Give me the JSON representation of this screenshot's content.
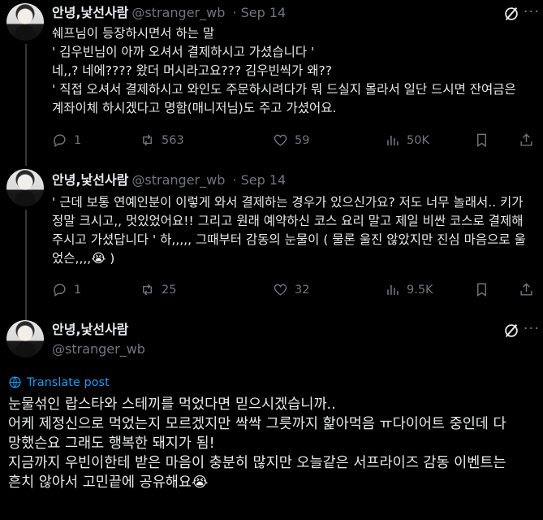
{
  "tweets": [
    {
      "author": "안녕,낯선사람",
      "handle": "@stranger_wb",
      "date": "Sep 14",
      "text": "쉐프님이 등장하시면서 하는 말\n' 김우빈님이 아까 오셔서 결제하시고 가셨습니다 '\n네,,? 네에???? 왔더 머시라고요??? 김우빈씩가 왜??\n' 직접 오셔서 결제하시고 와인도 주문하시려다가 뭐 드실지 몰라서 일단 드시면 잔여금은\n계좌이체 하시겠다고 명함(매니저님)도 주고 가셨어요.",
      "replies": "1",
      "reposts": "563",
      "likes": "59",
      "views": "50K"
    },
    {
      "author": "안녕,낯선사람",
      "handle": "@stranger_wb",
      "date": "Sep 14",
      "text": "' 근데 보통 연예인분이 이렇게 와서 결제하는 경우가 있으신가요? 저도 너무 놀래서.. 키가\n정말 크시고,, 멋있었어요!! 그리고 원래 예약하신 코스 요리 말고 제일 비싼 코스로 결제해\n주시고 가셨답니다 ' 하,,,,, 그때부터 감동의 눈물이 ( 물론 울진 않았지만 진심 마음으로 울\n었슨,,,,😭 )",
      "replies": "1",
      "reposts": "25",
      "likes": "32",
      "views": "9.5K"
    }
  ],
  "main": {
    "author": "안녕,낯선사람",
    "handle": "@stranger_wb",
    "translate": "Translate post",
    "text": "눈물섞인 랍스타와 스테끼를 먹었다면 믿으시겠습니까..\n어케 제정신으로 먹었는지 모르겠지만 싹싹 그릇까지 핥아먹음 ㅠ다이어트 중인데 다\n망했슨요 그래도 행복한 돼지가 됨!\n지금까지 우빈이한테 받은 마음이 충분히 많지만 오늘같은 서프라이즈 감동 이벤트는\n흔치 않아서 고민끝에 공유해요😭"
  },
  "icons": {
    "reply": "reply-icon",
    "repost": "repost-icon",
    "like": "heart-icon",
    "views": "views-icon",
    "bookmark": "bookmark-icon",
    "share": "share-icon",
    "grok": "grok-icon",
    "more": "more-icon",
    "globe": "globe-icon"
  }
}
